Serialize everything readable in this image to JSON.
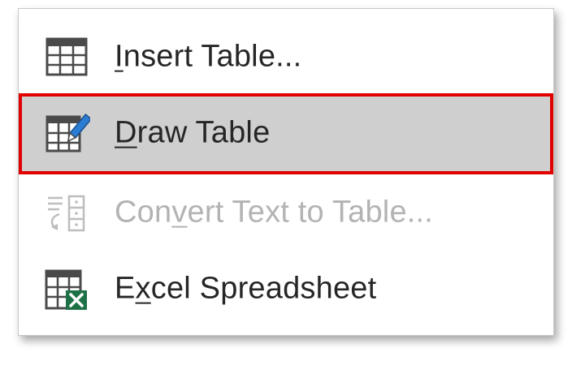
{
  "menu": {
    "items": [
      {
        "id": "insert-table",
        "icon": "table-grid-icon",
        "label_before": "",
        "label_ul": "I",
        "label_after": "nsert Table...",
        "state": "normal"
      },
      {
        "id": "draw-table",
        "icon": "draw-table-pencil-icon",
        "label_before": "",
        "label_ul": "D",
        "label_after": "raw Table",
        "state": "hovered"
      },
      {
        "id": "convert-text-to-table",
        "icon": "convert-text-to-table-icon",
        "label_before": "Con",
        "label_ul": "v",
        "label_after": "ert Text to Table...",
        "state": "disabled"
      },
      {
        "id": "excel-spreadsheet",
        "icon": "excel-spreadsheet-icon",
        "label_before": "E",
        "label_ul": "x",
        "label_after": "cel Spreadsheet",
        "state": "normal"
      }
    ],
    "colors": {
      "highlight_bg": "#cfcfcf",
      "highlight_border": "#e00000",
      "text": "#262626",
      "disabled_text": "#b3b3b3",
      "icon_dark": "#4a4a4a",
      "pencil_blue": "#2b7cd3",
      "excel_green": "#1e7145"
    }
  }
}
